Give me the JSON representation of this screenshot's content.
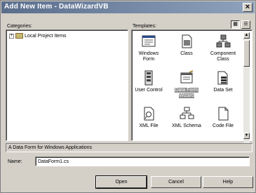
{
  "window": {
    "title": "Add New Item - DataWizardVB"
  },
  "categories": {
    "label": "Categories:",
    "items": [
      {
        "expander": "+",
        "label": "Local Project Items"
      }
    ]
  },
  "templates": {
    "label": "Templates:",
    "items": [
      {
        "label": "Windows Form",
        "icon": "windows-form-icon"
      },
      {
        "label": "Class",
        "icon": "class-icon"
      },
      {
        "label": "Component Class",
        "icon": "component-class-icon"
      },
      {
        "label": "User Control",
        "icon": "user-control-icon"
      },
      {
        "label": "Data Form Wizard",
        "icon": "data-form-wizard-icon",
        "selected": true
      },
      {
        "label": "Data Set",
        "icon": "data-set-icon"
      },
      {
        "label": "XML File",
        "icon": "xml-file-icon"
      },
      {
        "label": "XML Schema",
        "icon": "xml-schema-icon"
      },
      {
        "label": "Code File",
        "icon": "code-file-icon"
      }
    ]
  },
  "description": "A Data Form for Windows Applications",
  "name": {
    "label": "Name:",
    "value": "DataForm1.cs"
  },
  "buttons": {
    "open": "Open",
    "cancel": "Cancel",
    "help": "Help"
  },
  "colors": {
    "title_start": "#5a6e8c",
    "title_end": "#8fa2bd",
    "dialog": "#d4d0c8",
    "selected_bg": "#8a8a8a"
  }
}
